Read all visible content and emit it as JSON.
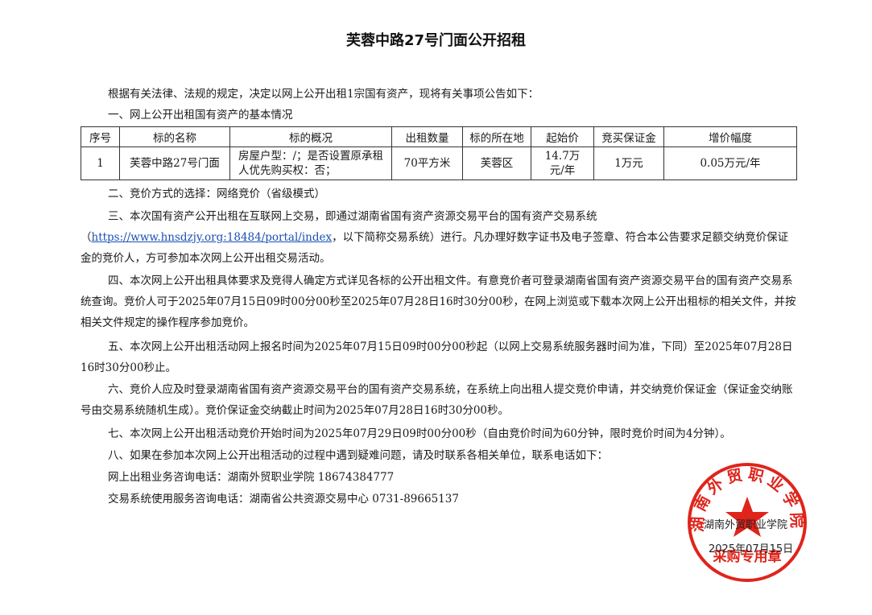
{
  "title": "芙蓉中路27号门面公开招租",
  "intro": "根据有关法律、法规的规定，决定以网上公开出租1宗国有资产，现将有关事项公告如下：",
  "section1": "一、网上公开出租国有资产的基本情况",
  "table": {
    "headers": [
      "序号",
      "标的名称",
      "标的概况",
      "出租数量",
      "标的所在地",
      "起始价",
      "竞买保证金",
      "增价幅度"
    ],
    "rows": [
      [
        "1",
        "芙蓉中路27号门面",
        "房屋户型：/；是否设置原承租人优先购买权：否；",
        "70平方米",
        "芙蓉区",
        "14.7万元/年",
        "1万元",
        "0.05万元/年"
      ]
    ]
  },
  "section2": "二、竞价方式的选择：网络竞价（省级模式）",
  "section3_a": "三、本次国有资产公开出租在互联网上交易，即通过湖南省国有资产资源交易平台的国有资产交易系统",
  "section3_paren_open": "（",
  "section3_link": "https://www.hnsdzjy.org:18484/portal/index",
  "section3_b": "，以下简称交易系统）进行。凡办理好数字证书及电子签章、符合本公告要求足额交纳竞价保证金的竞价人，方可参加本次网上公开出租交易活动。",
  "section4": "四、本次网上公开出租具体要求及竞得人确定方式详见各标的公开出租文件。有意竞价者可登录湖南省国有资产资源交易平台的国有资产交易系统查询。竞价人可于2025年07月15日09时00分00秒至2025年07月28日16时30分00秒，在网上浏览或下载本次网上公开出租标的相关文件，并按相关文件规定的操作程序参加竞价。",
  "section5": "五、本次网上公开出租活动网上报名时间为2025年07月15日09时00分00秒起（以网上交易系统服务器时间为准，下同）至2025年07月28日16时30分00秒止。",
  "section6": "六、竞价人应及时登录湖南省国有资产资源交易平台的国有资产交易系统，在系统上向出租人提交竞价申请，并交纳竞价保证金（保证金交纳账号由交易系统随机生成）。竞价保证金交纳截止时间为2025年07月28日16时30分00秒。",
  "section7": "七、本次网上公开出租活动竞价开始时间为2025年07月29日09时00分00秒（自由竞价时间为60分钟，限时竞价时间为4分钟）。",
  "section8": "八、如果在参加本次网上公开出租活动的过程中遇到疑难问题，请及时联系各相关单位，联系电话如下：",
  "contact1": "网上出租业务咨询电话：湖南外贸职业学院  18674384777",
  "contact2": "交易系统使用服务咨询电话：湖南省公共资源交易中心  0731-89665137",
  "signature": {
    "org": "湖南外贸职业学院",
    "date": "2025年07月15日"
  },
  "seal": {
    "arc_text": "湖南外贸职业学院",
    "bottom_text": "采购专用章",
    "color": "#e0241b"
  }
}
